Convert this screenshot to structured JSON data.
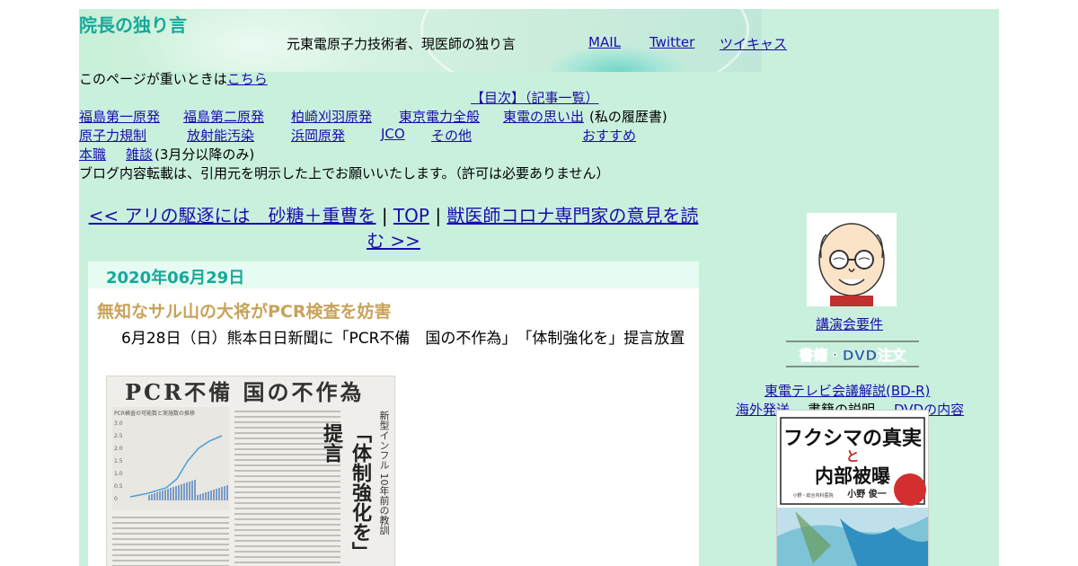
{
  "header": {
    "site_title": "院長の独り言",
    "tagline": "元東電原子力技術者、現医師の独り言",
    "links": {
      "mail": "MAIL",
      "twitter": "Twitter",
      "twitcast": "ツイキャス"
    }
  },
  "notice": {
    "text": "このページが重いときは",
    "link": "こちら"
  },
  "toc": {
    "label": "【目次】（記事一覧）"
  },
  "nav": {
    "row1": [
      "福島第一原発",
      "福島第二原発",
      "柏崎刈羽原発",
      "東京電力全般",
      "東電の思い出"
    ],
    "row1_suffix": "(私の履歴書)",
    "row2": [
      "原子力規制",
      "放射能汚染",
      "浜岡原発",
      "JCO",
      "その他",
      "おすすめ"
    ],
    "row3": [
      "本職",
      "雑談"
    ],
    "row3_suffix": "(3月分以降のみ)"
  },
  "reprint_notice": "ブログ内容転載は、引用元を明示した上でお願いいたします。（許可は必要ありません）",
  "pager": {
    "prev": "<< アリの駆逐には　砂糖＋重曹を",
    "sep": "|",
    "top": "TOP",
    "next": "獣医師コロナ専門家の意見を読む >>"
  },
  "post": {
    "date": "2020年06月29日",
    "title": "無知なサル山の大将がPCR検査を妨害",
    "body": "6月28日（日）熊本日日新聞に「PCR不備　国の不作為」　「体制強化を」提言放置"
  },
  "clipping": {
    "headline": "PCR不備 国の不作為",
    "side_text": "新型インフル 10年前の教訓",
    "big_text": "「体制強化を」提言",
    "chart": {
      "caption": "PCR検査の可能数と実施数の推移",
      "ticks": [
        "3.0",
        "2.5",
        "2.0",
        "1.5",
        "1.0",
        "0.5",
        "0"
      ]
    }
  },
  "sidebar": {
    "lecture": "講演会要件",
    "order_badge": "書籍・DVD注文",
    "tv_link": "東電テレビ会議解説(BD-R)",
    "overseas": "海外発送",
    "book_desc": "書籍の説明",
    "dvd_contents": "DVDの内容",
    "book": {
      "title1": "フクシマの真実",
      "title2": "と",
      "title3": "内部被曝",
      "author": "小野 俊一",
      "sub": "小野・総合内科医院"
    }
  },
  "colors": {
    "page_bg": "#c9f0dd",
    "title": "#16a89a",
    "post_title": "#c8a35a",
    "link": "#1a0dab"
  }
}
